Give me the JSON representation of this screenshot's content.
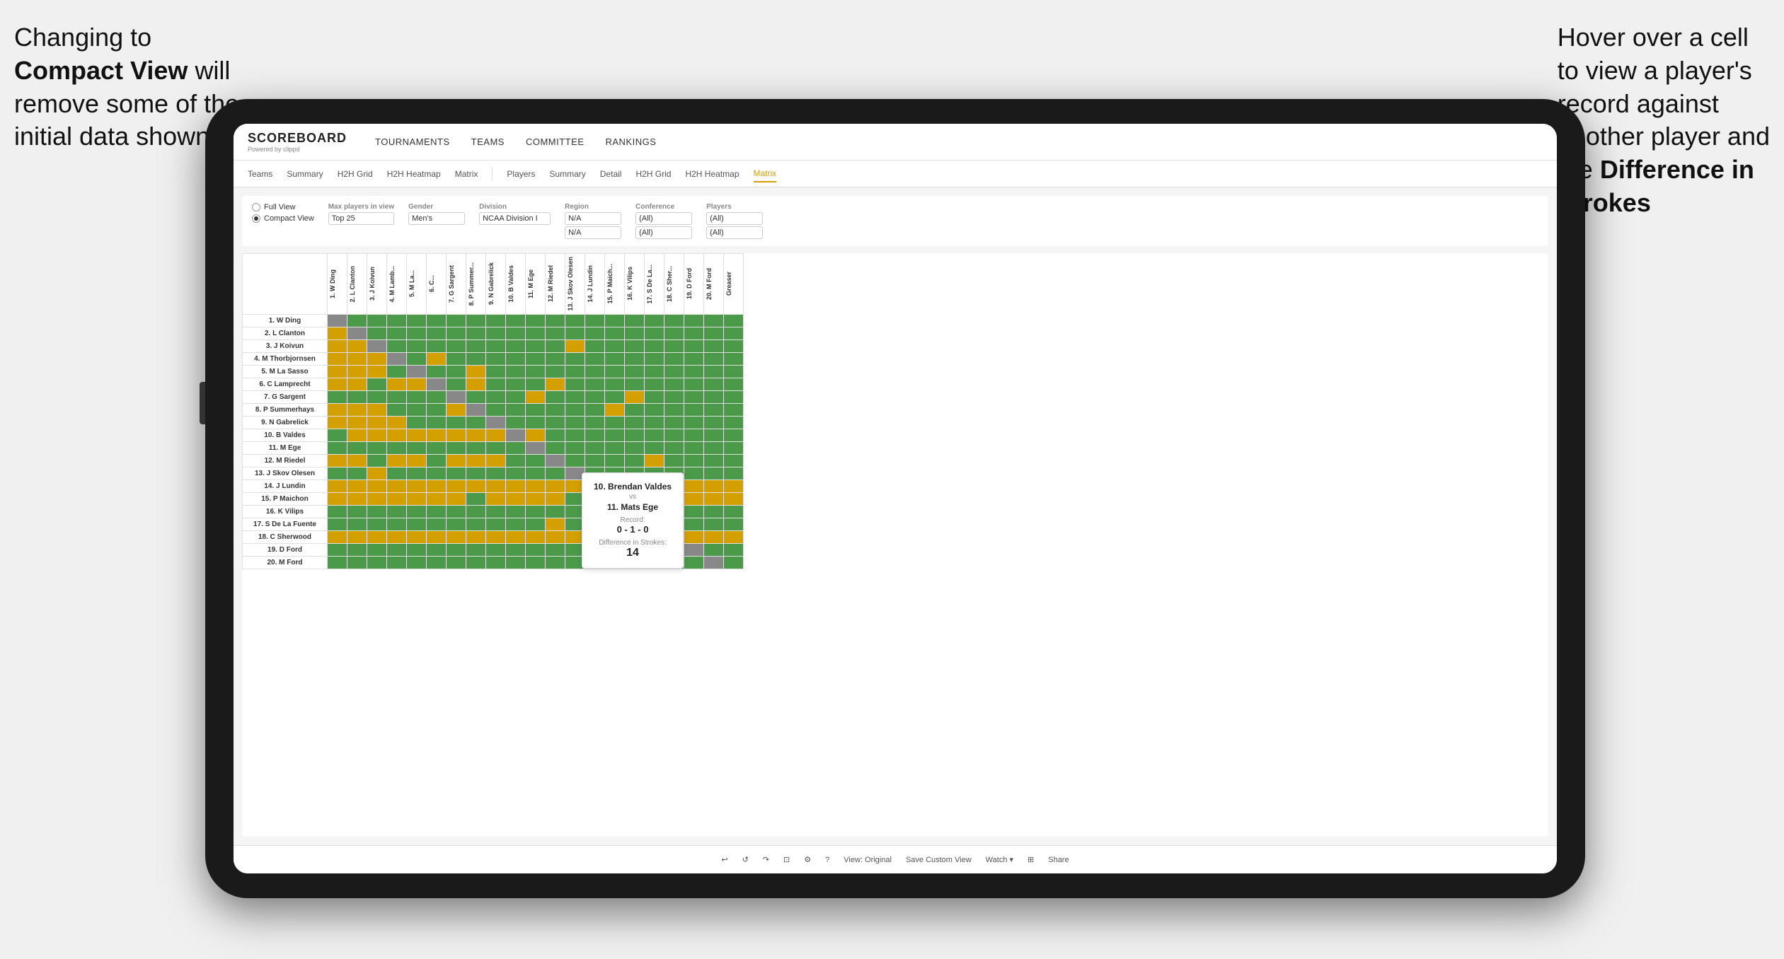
{
  "annotations": {
    "left": {
      "line1": "Changing to",
      "line2": "Compact View will",
      "line3": "remove some of the",
      "line4": "initial data shown"
    },
    "right": {
      "line1": "Hover over a cell",
      "line2": "to view a player's",
      "line3": "record against",
      "line4": "another player and",
      "line5": "the",
      "line6_bold": "Difference in Strokes"
    }
  },
  "nav": {
    "logo": "SCOREBOARD",
    "logo_sub": "Powered by clippd",
    "items": [
      "TOURNAMENTS",
      "TEAMS",
      "COMMITTEE",
      "RANKINGS"
    ]
  },
  "tabs": {
    "groups": [
      {
        "items": [
          "Teams",
          "Summary",
          "H2H Grid",
          "H2H Heatmap",
          "Matrix"
        ]
      },
      {
        "items": [
          "Players",
          "Summary",
          "Detail",
          "H2H Grid",
          "H2H Heatmap",
          "Matrix"
        ]
      }
    ],
    "active": "Matrix"
  },
  "filters": {
    "view_options": [
      "Full View",
      "Compact View"
    ],
    "selected_view": "Compact View",
    "max_players_label": "Max players in view",
    "max_players_value": "Top 25",
    "gender_label": "Gender",
    "gender_value": "Men's",
    "division_label": "Division",
    "division_value": "NCAA Division I",
    "region_label": "Region",
    "region_values": [
      "N/A",
      "N/A"
    ],
    "conference_label": "Conference",
    "conference_values": [
      "(All)",
      "(All)"
    ],
    "players_label": "Players",
    "players_values": [
      "(All)",
      "(All)"
    ]
  },
  "players": [
    "1. W Ding",
    "2. L Clanton",
    "3. J Koivun",
    "4. M Thorbjornsen",
    "5. M La Sasso",
    "6. C Lamprecht",
    "7. G Sargent",
    "8. P Summerhays",
    "9. N Gabrelick",
    "10. B Valdes",
    "11. M Ege",
    "12. M Riedel",
    "13. J Skov Olesen",
    "14. J Lundin",
    "15. P Maichon",
    "16. K Vilips",
    "17. S De La Fuente",
    "18. C Sherwood",
    "19. D Ford",
    "20. M Ford"
  ],
  "col_headers": [
    "1. W Ding",
    "2. L Clanton",
    "3. J Koivun",
    "4. M Lamb...",
    "5. M La...",
    "6. C...",
    "7. G Sargent",
    "8. P Summer...",
    "9. N Gabrelick",
    "10. B Valdes",
    "11. M Ege",
    "12. M Ried...",
    "13. J Skov Olesen",
    "14. J Lundin",
    "15. P Maich...",
    "16. K Vilips",
    "17. S De La...",
    "18. C Sher...",
    "19. D Ford",
    "20. M Ford",
    "Greaser"
  ],
  "tooltip": {
    "player1": "10. Brendan Valdes",
    "vs": "vs",
    "player2": "11. Mats Ege",
    "record_label": "Record:",
    "record": "0 - 1 - 0",
    "diff_label": "Difference in Strokes:",
    "diff": "14"
  },
  "toolbar": {
    "undo": "↩",
    "redo": "↪",
    "view_original": "View: Original",
    "save_custom": "Save Custom View",
    "watch": "Watch ▾",
    "share": "Share"
  }
}
